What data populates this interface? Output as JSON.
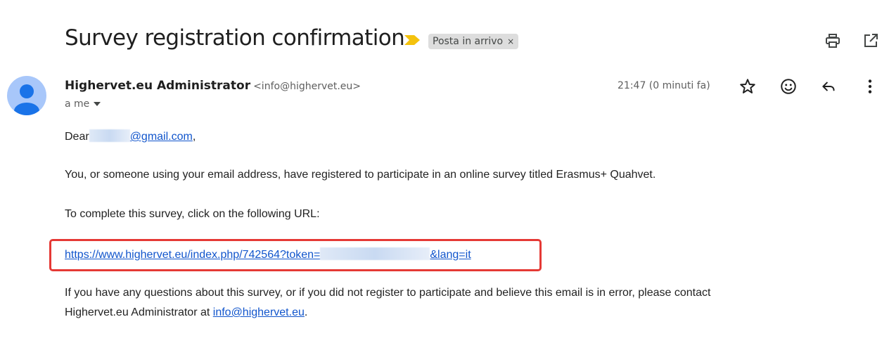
{
  "email": {
    "subject": "Survey registration confirmation",
    "label_chip": "Posta in arrivo",
    "label_remove": "×",
    "sender_name": "Highervet.eu Administrator",
    "sender_email": "<info@highervet.eu>",
    "recipient_line": "a me",
    "timestamp": "21:47 (0 minuti fa)"
  },
  "body": {
    "greeting_prefix": "Dear",
    "greeting_email_suffix": "@gmail.com",
    "greeting_comma": ",",
    "paragraph_1": "You, or someone using your email address, have registered to participate in an online survey titled Erasmus+ Quahvet.",
    "paragraph_2": "To complete this survey, click on the following URL:",
    "url_prefix": "https://www.highervet.eu/index.php/742564?token=",
    "url_suffix": "&lang=it",
    "paragraph_3_line1": "If you have any questions about this survey, or if you did not register to participate and believe this email is in error, please contact",
    "paragraph_3_line2_prefix": "Highervet.eu Administrator at ",
    "contact_link": "info@highervet.eu",
    "paragraph_3_line2_suffix": "."
  },
  "colors": {
    "link": "#1155cc",
    "highlight_box": "#e53935",
    "important_marker": "#f4c20d",
    "avatar_bg": "#a8c7fa",
    "avatar_fg": "#1a73e8"
  },
  "icons": [
    "important-marker-icon",
    "print-icon",
    "open-in-new-window-icon",
    "star-icon",
    "emoji-reaction-icon",
    "reply-icon",
    "more-options-icon",
    "avatar-icon"
  ]
}
